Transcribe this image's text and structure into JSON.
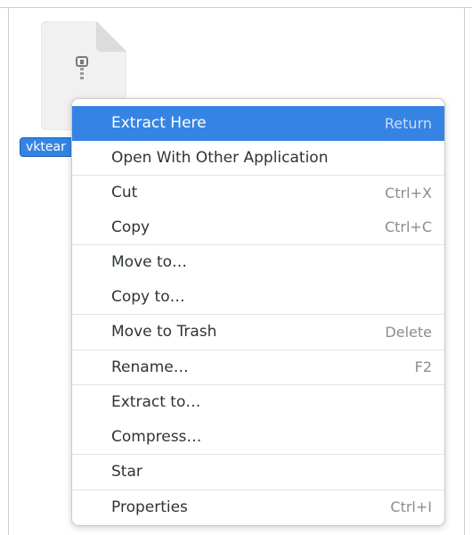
{
  "file": {
    "name": "vktear",
    "icon": "archive-file-icon"
  },
  "context_menu": {
    "groups": [
      [
        {
          "label": "Extract Here",
          "accel": "Return",
          "highlighted": true
        },
        {
          "label": "Open With Other Application",
          "accel": ""
        }
      ],
      [
        {
          "label": "Cut",
          "accel": "Ctrl+X"
        },
        {
          "label": "Copy",
          "accel": "Ctrl+C"
        }
      ],
      [
        {
          "label": "Move to…",
          "accel": ""
        },
        {
          "label": "Copy to…",
          "accel": ""
        }
      ],
      [
        {
          "label": "Move to Trash",
          "accel": "Delete"
        }
      ],
      [
        {
          "label": "Rename…",
          "accel": "F2"
        }
      ],
      [
        {
          "label": "Extract to…",
          "accel": ""
        },
        {
          "label": "Compress…",
          "accel": ""
        }
      ],
      [
        {
          "label": "Star",
          "accel": ""
        }
      ],
      [
        {
          "label": "Properties",
          "accel": "Ctrl+I"
        }
      ]
    ]
  },
  "colors": {
    "accent": "#3584e4",
    "text": "#2e3436",
    "accel": "#8a8e90"
  }
}
